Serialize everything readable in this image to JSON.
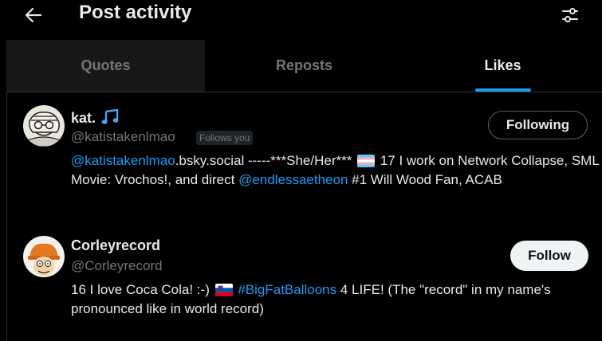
{
  "header": {
    "title": "Post activity",
    "back_icon": "arrow-left-icon",
    "filter_icon": "sliders-icon"
  },
  "tabs": [
    {
      "label": "Quotes",
      "state": "hovered"
    },
    {
      "label": "Reposts",
      "state": "default"
    },
    {
      "label": "Likes",
      "state": "active"
    }
  ],
  "colors": {
    "accent": "#1d9bf0",
    "background": "#000000",
    "text": "#e7e9ea",
    "muted": "#71767b"
  },
  "users": [
    {
      "name": "kat.",
      "name_icon": "music-note-icon",
      "handle": "@katistakenlmao",
      "follows_you": "Follows you",
      "button": "Following",
      "bio": {
        "link1": "@katistakenlmao",
        "text1": ".bsky.social -----***She/Her***",
        "flag1": "transgender-flag-icon",
        "text2": "17 I work on Network Collapse, SML Movie: Vrochos!, and direct",
        "link2": "@endlessaetheon",
        "text3": "#1 Will Wood Fan, ACAB"
      }
    },
    {
      "name": "Corleyrecord",
      "handle": "@Corleyrecord",
      "button": "Follow",
      "bio": {
        "text1": "16 I love Coca Cola! :-)",
        "flag1": "slovenia-flag-icon",
        "link1": "#BigFatBalloons",
        "text2": "4 LIFE! (The \"record\" in my name's pronounced like in world record)"
      }
    }
  ]
}
